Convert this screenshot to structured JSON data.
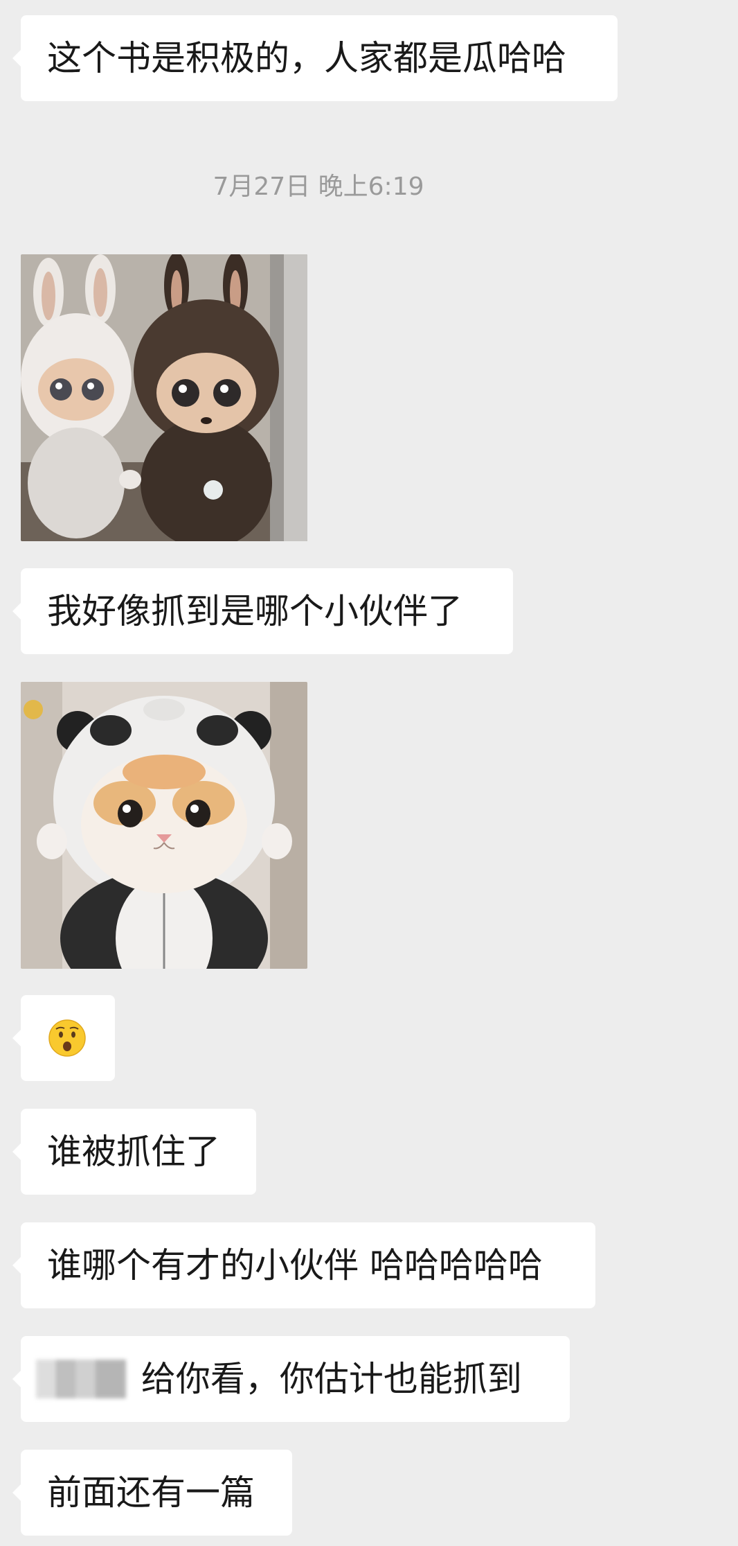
{
  "messages": {
    "m1": "这个书是积极的，人家都是瓜哈哈",
    "timestamp": "7月27日 晚上6:19",
    "m2": "我好像抓到是哪个小伙伴了",
    "m3_emoji_name": "hushed-face-emoji",
    "m4": "谁被抓住了",
    "m5": "谁哪个有才的小伙伴 哈哈哈哈哈",
    "m6": "给你看，你估计也能抓到",
    "m7": "前面还有一篇"
  },
  "images": {
    "img1": "labubu-dolls-photo",
    "img2": "kitten-in-panda-hood-photo"
  },
  "colors": {
    "background": "#ededed",
    "bubble": "#ffffff",
    "text": "#191919",
    "timestamp": "#9a9a9a"
  }
}
